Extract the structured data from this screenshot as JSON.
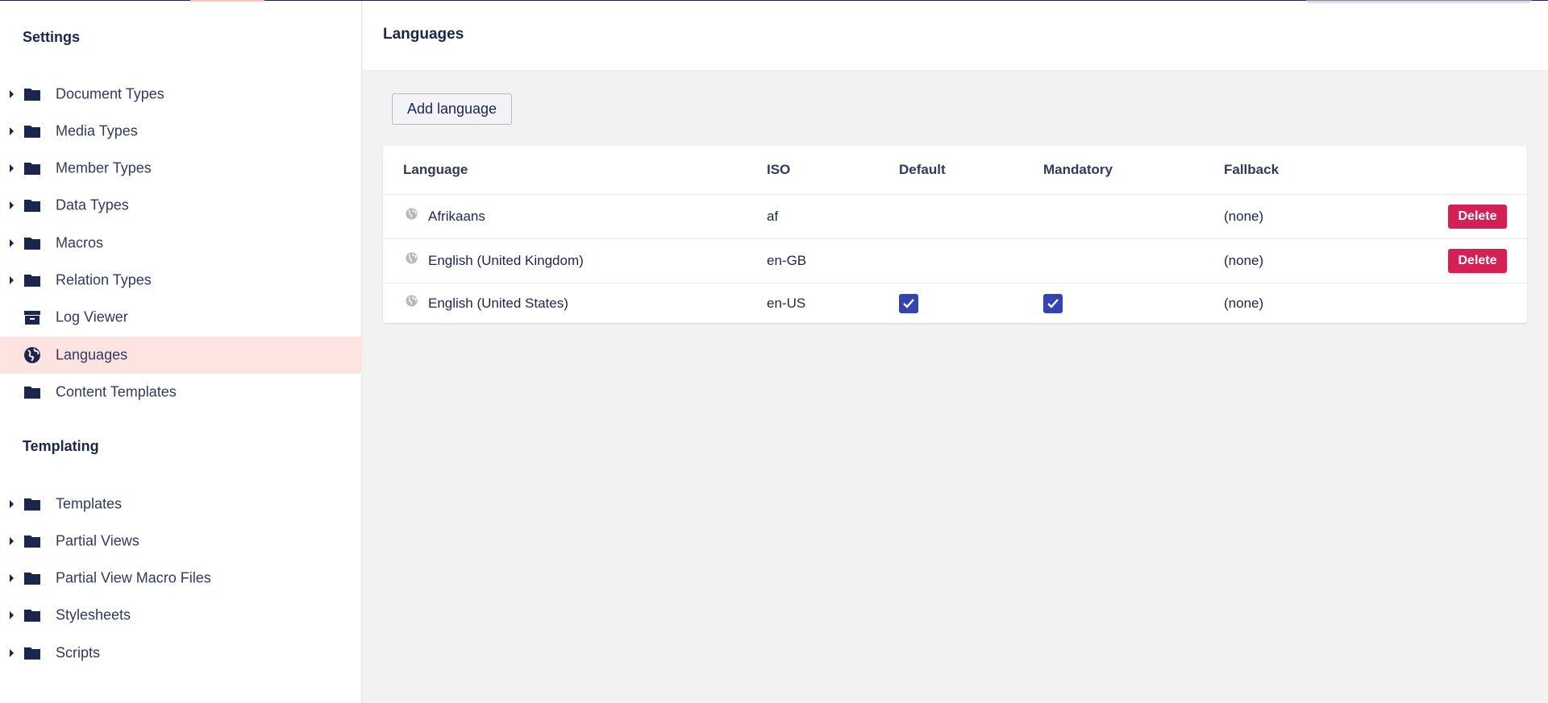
{
  "sidebar": {
    "settings_title": "Settings",
    "settings_items": [
      {
        "label": "Document Types",
        "icon": "folder-icon"
      },
      {
        "label": "Media Types",
        "icon": "folder-icon"
      },
      {
        "label": "Member Types",
        "icon": "folder-icon"
      },
      {
        "label": "Data Types",
        "icon": "folder-icon"
      },
      {
        "label": "Macros",
        "icon": "folder-icon"
      },
      {
        "label": "Relation Types",
        "icon": "folder-icon"
      },
      {
        "label": "Log Viewer",
        "icon": "archive-icon"
      },
      {
        "label": "Languages",
        "icon": "globe-icon"
      },
      {
        "label": "Content Templates",
        "icon": "folder-icon"
      }
    ],
    "templating_title": "Templating",
    "templating_items": [
      {
        "label": "Templates",
        "icon": "folder-icon"
      },
      {
        "label": "Partial Views",
        "icon": "folder-icon"
      },
      {
        "label": "Partial View Macro Files",
        "icon": "folder-icon"
      },
      {
        "label": "Stylesheets",
        "icon": "folder-icon"
      },
      {
        "label": "Scripts",
        "icon": "folder-icon"
      }
    ],
    "active_item": "Languages"
  },
  "header": {
    "title": "Languages"
  },
  "toolbar": {
    "add_label": "Add language"
  },
  "table": {
    "columns": [
      "Language",
      "ISO",
      "Default",
      "Mandatory",
      "Fallback"
    ],
    "rows": [
      {
        "language": "Afrikaans",
        "iso": "af",
        "default": false,
        "mandatory": false,
        "fallback": "(none)",
        "delete_label": "Delete"
      },
      {
        "language": "English (United Kingdom)",
        "iso": "en-GB",
        "default": false,
        "mandatory": false,
        "fallback": "(none)",
        "delete_label": "Delete"
      },
      {
        "language": "English (United States)",
        "iso": "en-US",
        "default": true,
        "mandatory": true,
        "fallback": "(none)"
      }
    ]
  },
  "colors": {
    "navy": "#1b264f",
    "active_bg": "#fee4e1",
    "delete_red": "#d42054",
    "checkbox_blue": "#3544b1"
  }
}
